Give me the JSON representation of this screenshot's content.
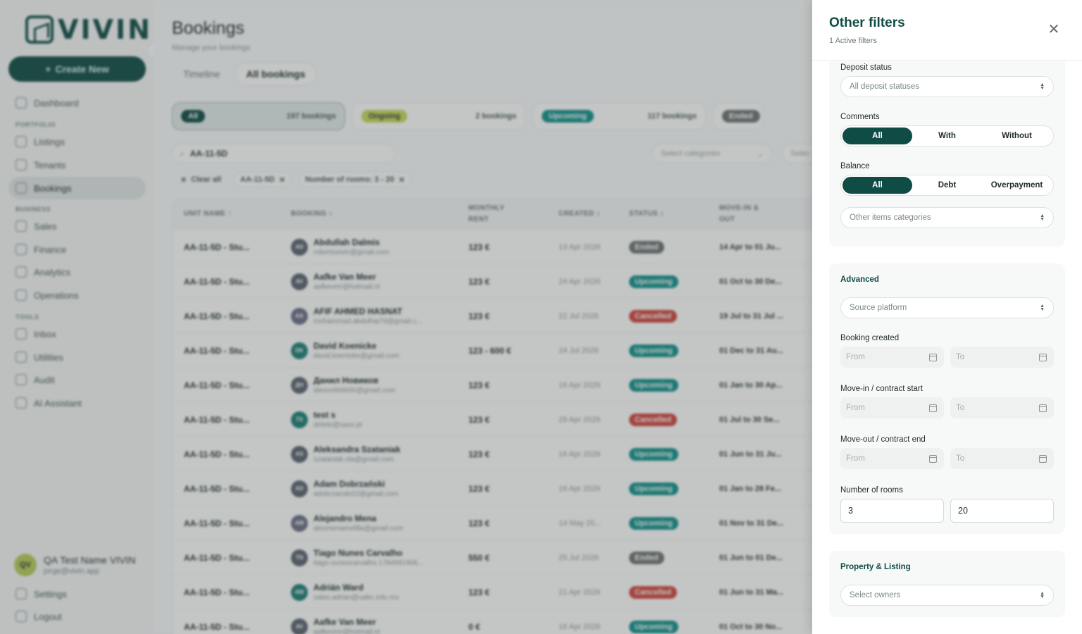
{
  "app": {
    "logo": "VIVIN",
    "create_new": "Create New",
    "nav": {
      "dashboard": "Dashboard",
      "portfolio_section": "PORTFOLIO",
      "listings": "Listings",
      "tenants": "Tenants",
      "bookings": "Bookings",
      "business_section": "BUSINESS",
      "sales": "Sales",
      "finance": "Finance",
      "analytics": "Analytics",
      "operations": "Operations",
      "tools_section": "TOOLS",
      "inbox": "Inbox",
      "utilities": "Utilities",
      "audit": "Audit",
      "ai_assistant": "AI Assistant",
      "settings": "Settings",
      "logout": "Logout"
    },
    "user": {
      "initials": "QV",
      "name": "QA Test Name VIVIN",
      "email": "jorge@vivin.app"
    }
  },
  "page": {
    "title": "Bookings",
    "subtitle": "Manage your bookings",
    "tabs": [
      "Timeline",
      "All bookings"
    ],
    "status_cards": [
      {
        "pill": "All",
        "count": "197 bookings",
        "pill_color": "#0f4c45",
        "pill_text": "#ffffff"
      },
      {
        "pill": "Ongoing",
        "count": "2 bookings",
        "pill_color": "#c7d95a",
        "pill_text": "#2a3735"
      },
      {
        "pill": "Upcoming",
        "count": "117 bookings",
        "pill_color": "#12918a",
        "pill_text": "#ffffff"
      },
      {
        "pill": "Ended",
        "count": "",
        "pill_color": "#6f7574",
        "pill_text": "#ffffff"
      }
    ],
    "search_value": "AA-11-5D",
    "select_categories": "Select categories",
    "select_trunc": "Selec",
    "chips": {
      "clear_all": "Clear all",
      "chip1": "AA-11-5D",
      "chip2": "Number of rooms: 3 - 20"
    },
    "columns": {
      "unit": "UNIT NAME ↑",
      "booking": "BOOKING ↕",
      "rent": "MONTHLY RENT",
      "created": "CREATED ↕",
      "status": "STATUS ↕",
      "move": "MOVE-IN & OUT"
    },
    "rows": [
      {
        "unit": "AA-11-5D - Stu...",
        "initials": "AD",
        "name": "Abdullah Dalmis",
        "email": "robertovivin@gmail.com",
        "rent": "123 €",
        "created": "13 Apr 2026",
        "status": "Ended",
        "move": "14 Apr to 01 Ju...",
        "av_color": "#5b6370"
      },
      {
        "unit": "AA-11-5D - Stu...",
        "initials": "AV",
        "name": "Aafke Van Meer",
        "email": "aafkevmr@hotmail.nl",
        "rent": "123 €",
        "created": "24 Apr 2026",
        "status": "Upcoming",
        "move": "01 Oct to 30 De...",
        "av_color": "#5b6370"
      },
      {
        "unit": "AA-11-5D - Stu...",
        "initials": "AA",
        "name": "AFIF AHMED HASNAT",
        "email": "mohammad.abdulhai76@gmail.c...",
        "rent": "123 €",
        "created": "22 Jul 2026",
        "status": "Cancelled",
        "move": "19 Jul to 31 Jul ...",
        "av_color": "#6b6f86"
      },
      {
        "unit": "AA-11-5D - Stu...",
        "initials": "DK",
        "name": "David Koenicke",
        "email": "david.koenicke@gmail.com",
        "rent": "123 - 600 €",
        "created": "24 Jul 2026",
        "status": "Upcoming",
        "move": "01 Dec to 31 Au...",
        "av_color": "#1c7f74"
      },
      {
        "unit": "AA-11-5D - Stu...",
        "initials": "ДН",
        "name": "Данил Новиков",
        "email": "danov666666@gmail.com",
        "rent": "123 €",
        "created": "16 Apr 2026",
        "status": "Upcoming",
        "move": "01 Jan to 30 Ap...",
        "av_color": "#5b6370"
      },
      {
        "unit": "AA-11-5D - Stu...",
        "initials": "TS",
        "name": "test s",
        "email": "delete@sass.pt",
        "rent": "123 €",
        "created": "29 Apr 2026",
        "status": "Cancelled",
        "move": "01 Jul to 30 Se...",
        "av_color": "#1c7f74"
      },
      {
        "unit": "AA-11-5D - Stu...",
        "initials": "AS",
        "name": "Aleksandra Szataniak",
        "email": "szataniak.ola@gmail.com",
        "rent": "123 €",
        "created": "16 Apr 2026",
        "status": "Upcoming",
        "move": "01 Jun to 31 Ju...",
        "av_color": "#5b6370"
      },
      {
        "unit": "AA-11-5D - Stu...",
        "initials": "AD",
        "name": "Adam Dobrzański",
        "email": "adobrzanski22@gmail.com",
        "rent": "123 €",
        "created": "16 Apr 2026",
        "status": "Upcoming",
        "move": "01 Jan to 28 Fe...",
        "av_color": "#5b6370"
      },
      {
        "unit": "AA-11-5D - Stu...",
        "initials": "AM",
        "name": "Alejandro Mena",
        "email": "alexmenamelilla@gmail.com",
        "rent": "123 €",
        "created": "14 May 20...",
        "status": "Upcoming",
        "move": "01 Nov to 31 De...",
        "av_color": "#6b6f86"
      },
      {
        "unit": "AA-11-5D - Stu...",
        "initials": "TN",
        "name": "Tiago Nunes Carvalho",
        "email": "tiago.nunescarvalho.1784991906...",
        "rent": "550 €",
        "created": "25 Jul 2026",
        "status": "Ended",
        "move": "01 Jun to 01 De...",
        "av_color": "#5b6370"
      },
      {
        "unit": "AA-11-5D - Stu...",
        "initials": "AW",
        "name": "Adrián Ward",
        "email": "salas.adrian@uabc.edu.mx",
        "rent": "123 €",
        "created": "21 Apr 2026",
        "status": "Cancelled",
        "move": "01 Jun to 31 Ma...",
        "av_color": "#1c7f74"
      },
      {
        "unit": "AA-11-5D - Stu...",
        "initials": "AV",
        "name": "Aafke Van Meer",
        "email": "aafkevmr@hotmail.nl",
        "rent": "0 €",
        "created": "16 Apr 2026",
        "status": "Upcoming",
        "move": "01 Oct to 30 No...",
        "av_color": "#5b6370"
      }
    ],
    "status_colors": {
      "Ended": "#6f7574",
      "Upcoming": "#12918a",
      "Cancelled": "#d1463f"
    }
  },
  "drawer": {
    "title": "Other filters",
    "active_count": "1 Active filters",
    "deposit_status": {
      "label": "Deposit status",
      "placeholder": "All deposit statuses"
    },
    "comments": {
      "label": "Comments",
      "options": [
        "All",
        "With",
        "Without"
      ],
      "selected": "All"
    },
    "balance": {
      "label": "Balance",
      "options": [
        "All",
        "Debt",
        "Overpayment"
      ],
      "selected": "All"
    },
    "other_items": {
      "placeholder": "Other items categories"
    },
    "advanced": {
      "heading": "Advanced",
      "source_platform": "Source platform",
      "booking_created": "Booking created",
      "move_in": "Move-in / contract start",
      "move_out": "Move-out / contract end",
      "from": "From",
      "to": "To",
      "rooms_label": "Number of rooms",
      "rooms_min": "3",
      "rooms_max": "20"
    },
    "property": {
      "heading": "Property & Listing",
      "owners_placeholder": "Select owners"
    },
    "colors": {
      "accent": "#0f4c45"
    }
  }
}
